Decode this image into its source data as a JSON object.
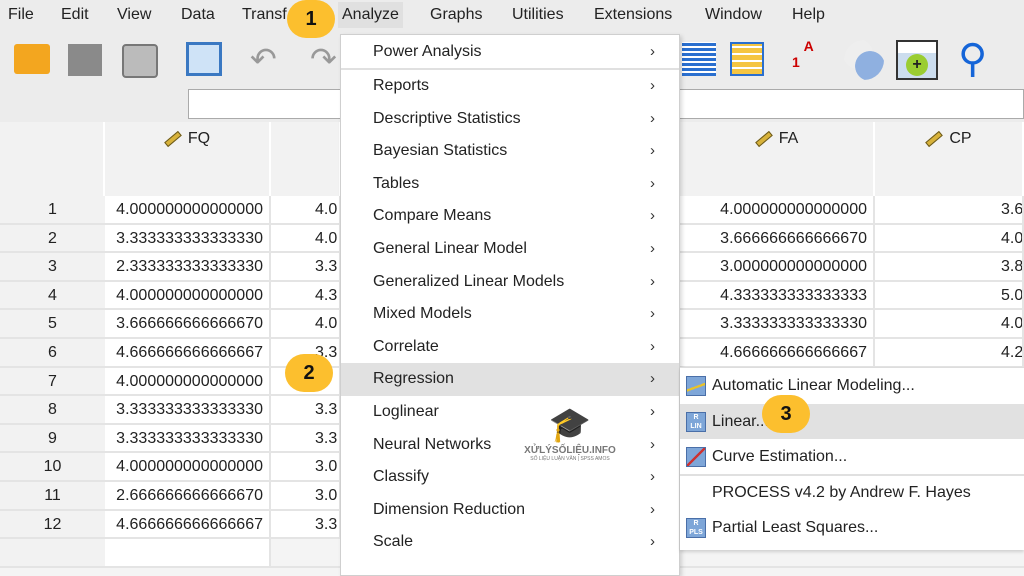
{
  "menubar": [
    "File",
    "Edit",
    "View",
    "Data",
    "Transf",
    "Analyze",
    "Graphs",
    "Utilities",
    "Extensions",
    "Window",
    "Help"
  ],
  "toolbar": [
    "open-folder-icon",
    "save-icon",
    "print-icon",
    "dialog-recall-icon",
    "undo-icon",
    "redo-icon",
    "data-grid-icon",
    "variables-grid-icon",
    "value-labels-icon",
    "use-sets-icon",
    "add-icon",
    "search-icon"
  ],
  "columns": {
    "c1": "FQ",
    "c3": "FA",
    "c4": "CP"
  },
  "rows": [
    {
      "n": "1",
      "fq": "4.000000000000000",
      "c2": "4.0",
      "fa": "4.000000000000000",
      "cp": "3.6"
    },
    {
      "n": "2",
      "fq": "3.333333333333330",
      "c2": "4.0",
      "fa": "3.666666666666670",
      "cp": "4.0"
    },
    {
      "n": "3",
      "fq": "2.333333333333330",
      "c2": "3.3",
      "fa": "3.000000000000000",
      "cp": "3.8"
    },
    {
      "n": "4",
      "fq": "4.000000000000000",
      "c2": "4.3",
      "fa": "4.333333333333333",
      "cp": "5.0"
    },
    {
      "n": "5",
      "fq": "3.666666666666670",
      "c2": "4.0",
      "fa": "3.333333333333330",
      "cp": "4.0"
    },
    {
      "n": "6",
      "fq": "4.666666666666667",
      "c2": "3.3",
      "fa": "4.666666666666667",
      "cp": "4.2"
    },
    {
      "n": "7",
      "fq": "4.000000000000000",
      "c2": "",
      "fa": "",
      "cp": ""
    },
    {
      "n": "8",
      "fq": "3.333333333333330",
      "c2": "3.3",
      "fa": "",
      "cp": ""
    },
    {
      "n": "9",
      "fq": "3.333333333333330",
      "c2": "3.3",
      "fa": "",
      "cp": ""
    },
    {
      "n": "10",
      "fq": "4.000000000000000",
      "c2": "3.0",
      "fa": "",
      "cp": ""
    },
    {
      "n": "11",
      "fq": "2.666666666666670",
      "c2": "3.0",
      "fa": "",
      "cp": ""
    },
    {
      "n": "12",
      "fq": "4.666666666666667",
      "c2": "3.3",
      "fa": "",
      "cp": ""
    }
  ],
  "analyze_menu": [
    "Power Analysis",
    "Reports",
    "Descriptive Statistics",
    "Bayesian Statistics",
    "Tables",
    "Compare Means",
    "General Linear Model",
    "Generalized Linear Models",
    "Mixed Models",
    "Correlate",
    "Regression",
    "Loglinear",
    "Neural Networks",
    "Classify",
    "Dimension Reduction",
    "Scale"
  ],
  "highlighted_menu_item": "Regression",
  "regression_submenu": [
    {
      "label": "Automatic Linear Modeling...",
      "icon": "auto-linear-icon"
    },
    {
      "label": "Linear...",
      "icon": "linear-regression-icon"
    },
    {
      "label": "Curve Estimation...",
      "icon": "curve-estimation-icon"
    },
    {
      "label": "PROCESS v4.2 by Andrew F. Hayes",
      "icon": ""
    },
    {
      "label": "Partial Least Squares...",
      "icon": "pls-icon"
    }
  ],
  "highlighted_submenu_item": "Linear...",
  "step_badges": [
    "1",
    "2",
    "3"
  ],
  "watermark": {
    "title": "XỬLÝSỐLIỆU.INFO",
    "subtitle": "SỐ LIỆU LUẬN VĂN | SPSS AMOS"
  },
  "colors": {
    "badge": "#fcbf2e",
    "highlight": "#e1e1e1",
    "chrome": "#ececec"
  }
}
